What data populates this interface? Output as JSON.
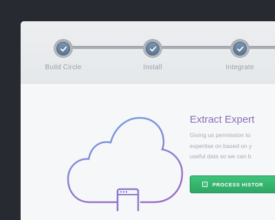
{
  "steps": [
    {
      "label": "Build Circle",
      "done": true
    },
    {
      "label": "Install",
      "done": true
    },
    {
      "label": "Integrate",
      "done": true
    }
  ],
  "main": {
    "title": "Extract Expert",
    "description_lines": [
      "Giving us permission to",
      "expertise on based on y",
      "useful data so we can b"
    ],
    "button_label": "PROCESS HISTOR"
  },
  "colors": {
    "accent": "#8a6fb8",
    "button_green": "#34b06d",
    "cloud_gradient_start": "#6fa6e2",
    "cloud_gradient_end": "#9a6fc8",
    "step_node": "#6683a0"
  },
  "icons": {
    "step": "checkmark-icon",
    "illustration": "cloud-icon",
    "device": "mobile-device-icon",
    "button": "square-icon"
  }
}
